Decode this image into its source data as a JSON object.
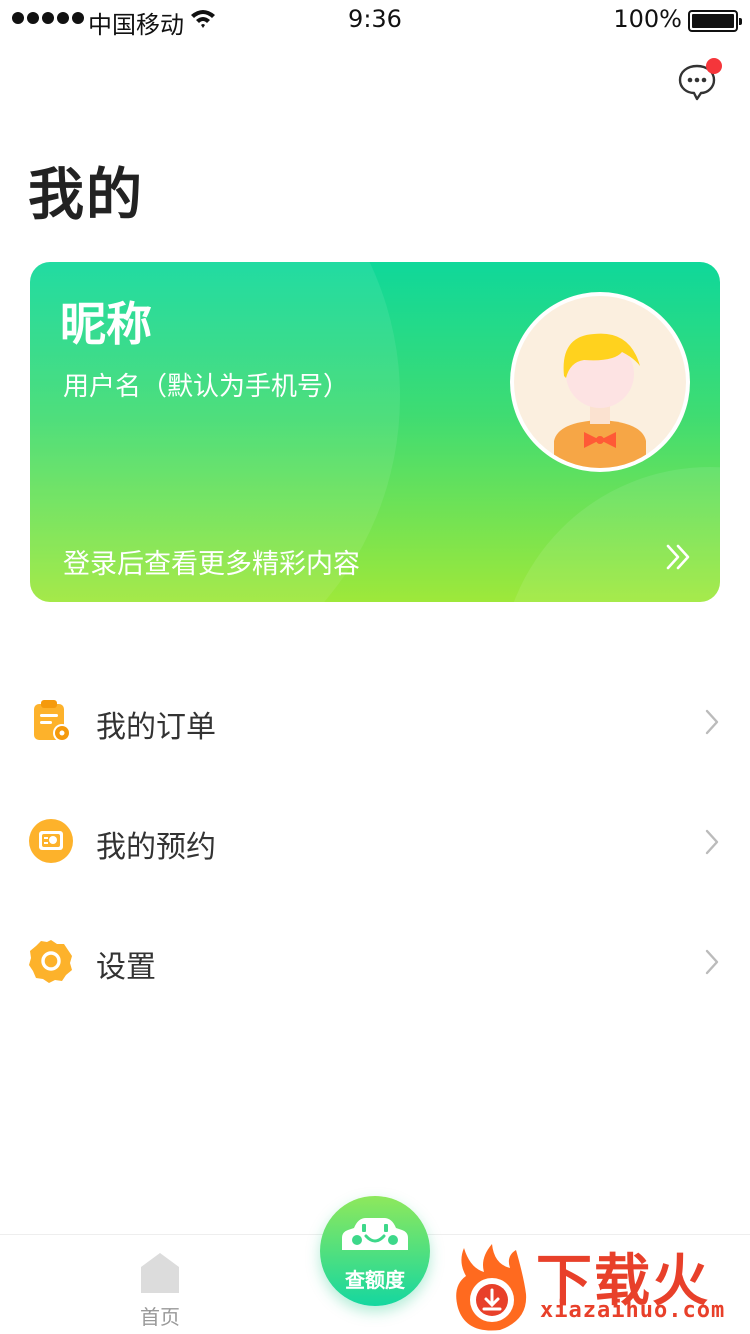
{
  "status_bar": {
    "carrier": "中国移动",
    "time": "9:36",
    "battery": "100%"
  },
  "page": {
    "title": "我的"
  },
  "profile": {
    "nickname": "昵称",
    "username": "用户名（默认为手机号）",
    "login_hint": "登录后查看更多精彩内容"
  },
  "menu": {
    "items": [
      {
        "label": "我的订单",
        "icon": "order-clipboard-icon"
      },
      {
        "label": "我的预约",
        "icon": "appointment-icon"
      },
      {
        "label": "设置",
        "icon": "settings-gear-icon"
      }
    ]
  },
  "tab_bar": {
    "home_label": "首页",
    "fab_label": "查额度"
  },
  "watermark": {
    "brand": "下载火",
    "url": "xiazaihuo.com"
  },
  "colors": {
    "card_gradient_top": "#0fd89a",
    "card_gradient_bottom": "#9ee83a",
    "icon_orange": "#fdb22b",
    "badge_red": "#f5363b",
    "watermark_red": "#e8402a"
  }
}
